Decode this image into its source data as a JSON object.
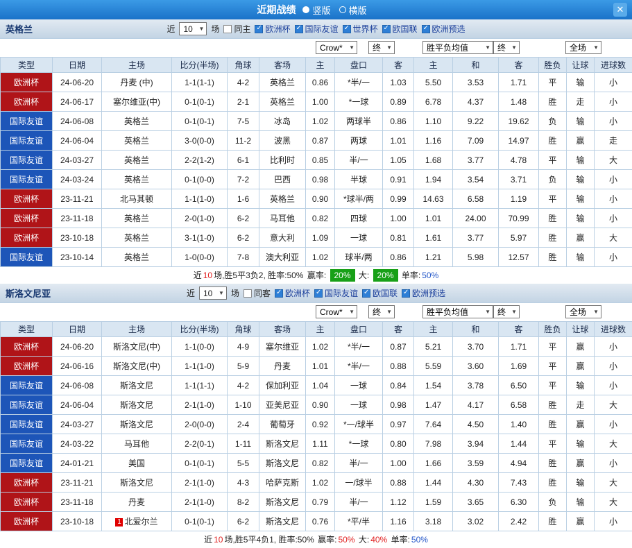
{
  "titlebar": {
    "title": "近期战绩",
    "vertical_label": "竖版",
    "horizontal_label": "横版",
    "close_glyph": "✕"
  },
  "colors": {
    "titlebar_top": "#3b9ae6",
    "titlebar_bottom": "#1a72c8",
    "close_bg": "#5aabea",
    "band_top": "#e2eaf2",
    "band_bottom": "#c3d4e4",
    "header_bg": "#d9e6f2",
    "grid_border": "#b9cfe3",
    "type_euro": "#b01418",
    "type_friendly": "#1d55b8",
    "team_green": "#009933",
    "team_red": "#e02020",
    "accent_red": "#e02020",
    "accent_green": "#089a30",
    "accent_orange": "#e07818",
    "accent_blue": "#2356c8",
    "badge_green": "#18a018",
    "navy_text": "#15356e",
    "league_label": "#1b3f9b"
  },
  "table_columns": [
    "类型",
    "日期",
    "主场",
    "比分(半场)",
    "角球",
    "客场",
    "主",
    "盘口",
    "客",
    "主",
    "和",
    "客",
    "胜负",
    "让球",
    "进球数"
  ],
  "sections": [
    {
      "team": "英格兰",
      "filter": {
        "near_label": "近",
        "count": "10",
        "matches_label": "场",
        "same_label": "同主",
        "same_checked": false,
        "leagues": [
          {
            "label": "欧洲杯",
            "checked": true
          },
          {
            "label": "国际友谊",
            "checked": true
          },
          {
            "label": "世界杯",
            "checked": true
          },
          {
            "label": "欧国联",
            "checked": true
          },
          {
            "label": "欧洲预选",
            "checked": true
          }
        ]
      },
      "selects": [
        {
          "name": "odds-company",
          "value": "Crow*"
        },
        {
          "name": "handicap-stage",
          "value": "终"
        },
        {
          "name": "europe-odds",
          "value": "胜平负均值"
        },
        {
          "name": "europe-stage",
          "value": "终"
        },
        {
          "name": "scope",
          "value": "全场"
        }
      ],
      "rows": [
        {
          "type": "欧洲杯",
          "tc": "euro",
          "date": "24-06-20",
          "home": "丹麦 (中)",
          "hc": "k",
          "score": "1-1(1-1)",
          "sc": "k",
          "corner": "4-2",
          "away": "英格兰",
          "ac": "g",
          "h": "0.86",
          "hcap": "*半/一",
          "a": "1.03",
          "eh": "5.50",
          "ed": "3.53",
          "ea": "1.71",
          "res": "平",
          "give": "输",
          "goal": "小"
        },
        {
          "type": "欧洲杯",
          "tc": "euro",
          "date": "24-06-17",
          "home": "塞尔维亚(中)",
          "hc": "k",
          "score": "0-1(0-1)",
          "sc": "k",
          "corner": "2-1",
          "away": "英格兰",
          "ac": "g",
          "h": "1.00",
          "hcap": "*一球",
          "a": "0.89",
          "eh": "6.78",
          "ed": "4.37",
          "ea": "1.48",
          "res": "胜",
          "give": "走",
          "goal": "小"
        },
        {
          "type": "国际友谊",
          "tc": "fri",
          "date": "24-06-08",
          "home": "英格兰",
          "hc": "g",
          "score": "0-1(0-1)",
          "sc": "k",
          "corner": "7-5",
          "away": "冰岛",
          "ac": "k",
          "h": "1.02",
          "hcap": "两球半",
          "a": "0.86",
          "eh": "1.10",
          "ed": "9.22",
          "ea": "19.62",
          "res": "负",
          "give": "输",
          "goal": "小"
        },
        {
          "type": "国际友谊",
          "tc": "fri",
          "date": "24-06-04",
          "home": "英格兰",
          "hc": "g",
          "score": "3-0(0-0)",
          "sc": "r",
          "corner": "11-2",
          "away": "波黑",
          "ac": "k",
          "h": "0.87",
          "hcap": "两球",
          "a": "1.01",
          "eh": "1.16",
          "ed": "7.09",
          "ea": "14.97",
          "res": "胜",
          "give": "赢",
          "goal": "走"
        },
        {
          "type": "国际友谊",
          "tc": "fri",
          "date": "24-03-27",
          "home": "英格兰",
          "hc": "g",
          "score": "2-2(1-2)",
          "sc": "k",
          "corner": "6-1",
          "away": "比利时",
          "ac": "k",
          "h": "0.85",
          "hcap": "半/一",
          "a": "1.05",
          "eh": "1.68",
          "ed": "3.77",
          "ea": "4.78",
          "res": "平",
          "give": "输",
          "goal": "大"
        },
        {
          "type": "国际友谊",
          "tc": "fri",
          "date": "24-03-24",
          "home": "英格兰",
          "hc": "g",
          "score": "0-1(0-0)",
          "sc": "k",
          "corner": "7-2",
          "away": "巴西",
          "ac": "k",
          "h": "0.98",
          "hcap": "半球",
          "a": "0.91",
          "eh": "1.94",
          "ed": "3.54",
          "ea": "3.71",
          "res": "负",
          "give": "输",
          "goal": "小"
        },
        {
          "type": "欧洲杯",
          "tc": "euro",
          "date": "23-11-21",
          "home": "北马其顿",
          "hc": "k",
          "score": "1-1(1-0)",
          "sc": "k",
          "corner": "1-6",
          "away": "英格兰",
          "ac": "g",
          "h": "0.90",
          "hcap": "*球半/两",
          "a": "0.99",
          "eh": "14.63",
          "ed": "6.58",
          "ea": "1.19",
          "res": "平",
          "give": "输",
          "goal": "小"
        },
        {
          "type": "欧洲杯",
          "tc": "euro",
          "date": "23-11-18",
          "home": "英格兰",
          "hc": "g",
          "score": "2-0(1-0)",
          "sc": "k",
          "corner": "6-2",
          "away": "马耳他",
          "ac": "k",
          "h": "0.82",
          "hcap": "四球",
          "a": "1.00",
          "eh": "1.01",
          "ed": "24.00",
          "ea": "70.99",
          "res": "胜",
          "give": "输",
          "goal": "小"
        },
        {
          "type": "欧洲杯",
          "tc": "euro",
          "date": "23-10-18",
          "home": "英格兰",
          "hc": "g",
          "score": "3-1(1-0)",
          "sc": "k",
          "corner": "6-2",
          "away": "意大利",
          "ac": "k",
          "h": "1.09",
          "hcap": "一球",
          "a": "0.81",
          "eh": "1.61",
          "ed": "3.77",
          "ea": "5.97",
          "res": "胜",
          "give": "赢",
          "goal": "大"
        },
        {
          "type": "国际友谊",
          "tc": "fri",
          "date": "23-10-14",
          "home": "英格兰",
          "hc": "g",
          "score": "1-0(0-0)",
          "sc": "k",
          "corner": "7-8",
          "away": "澳大利亚",
          "ac": "k",
          "h": "1.02",
          "hcap": "球半/两",
          "a": "0.86",
          "eh": "1.21",
          "ed": "5.98",
          "ea": "12.57",
          "res": "胜",
          "give": "输",
          "goal": "小"
        }
      ],
      "summary": [
        {
          "t": "近",
          "s": "n"
        },
        {
          "t": "10",
          "s": "red"
        },
        {
          "t": "场,胜5平3负2, 胜率:50%",
          "s": "n"
        },
        {
          "t": " 赢率: ",
          "s": "n"
        },
        {
          "t": "20%",
          "s": "badge"
        },
        {
          "t": " 大: ",
          "s": "n"
        },
        {
          "t": "20%",
          "s": "badge"
        },
        {
          "t": " 单率:",
          "s": "n"
        },
        {
          "t": "50%",
          "s": "blue"
        }
      ]
    },
    {
      "team": "斯洛文尼亚",
      "filter": {
        "near_label": "近",
        "count": "10",
        "matches_label": "场",
        "same_label": "同客",
        "same_checked": false,
        "leagues": [
          {
            "label": "欧洲杯",
            "checked": true
          },
          {
            "label": "国际友谊",
            "checked": true
          },
          {
            "label": "欧国联",
            "checked": true
          },
          {
            "label": "欧洲预选",
            "checked": true
          }
        ]
      },
      "selects": [
        {
          "name": "odds-company",
          "value": "Crow*"
        },
        {
          "name": "handicap-stage",
          "value": "终"
        },
        {
          "name": "europe-odds",
          "value": "胜平负均值"
        },
        {
          "name": "europe-stage",
          "value": "终"
        },
        {
          "name": "scope",
          "value": "全场"
        }
      ],
      "rows": [
        {
          "type": "欧洲杯",
          "tc": "euro",
          "date": "24-06-20",
          "home": "斯洛文尼(中)",
          "hc": "r",
          "score": "1-1(0-0)",
          "sc": "k",
          "corner": "4-9",
          "away": "塞尔维亚",
          "ac": "k",
          "h": "1.02",
          "hcap": "*半/一",
          "a": "0.87",
          "eh": "5.21",
          "ed": "3.70",
          "ea": "1.71",
          "res": "平",
          "give": "赢",
          "goal": "小"
        },
        {
          "type": "欧洲杯",
          "tc": "euro",
          "date": "24-06-16",
          "home": "斯洛文尼(中)",
          "hc": "r",
          "score": "1-1(1-0)",
          "sc": "k",
          "corner": "5-9",
          "away": "丹麦",
          "ac": "k",
          "h": "1.01",
          "hcap": "*半/一",
          "a": "0.88",
          "eh": "5.59",
          "ed": "3.60",
          "ea": "1.69",
          "res": "平",
          "give": "赢",
          "goal": "小"
        },
        {
          "type": "国际友谊",
          "tc": "fri",
          "date": "24-06-08",
          "home": "斯洛文尼",
          "hc": "r",
          "score": "1-1(1-1)",
          "sc": "k",
          "corner": "4-2",
          "away": "保加利亚",
          "ac": "k",
          "h": "1.04",
          "hcap": "一球",
          "a": "0.84",
          "eh": "1.54",
          "ed": "3.78",
          "ea": "6.50",
          "res": "平",
          "give": "输",
          "goal": "小"
        },
        {
          "type": "国际友谊",
          "tc": "fri",
          "date": "24-06-04",
          "home": "斯洛文尼",
          "hc": "r",
          "score": "2-1(1-0)",
          "sc": "k",
          "corner": "1-10",
          "away": "亚美尼亚",
          "ac": "k",
          "h": "0.90",
          "hcap": "一球",
          "a": "0.98",
          "eh": "1.47",
          "ed": "4.17",
          "ea": "6.58",
          "res": "胜",
          "give": "走",
          "goal": "大"
        },
        {
          "type": "国际友谊",
          "tc": "fri",
          "date": "24-03-27",
          "home": "斯洛文尼",
          "hc": "r",
          "score": "2-0(0-0)",
          "sc": "k",
          "corner": "2-4",
          "away": "葡萄牙",
          "ac": "k",
          "h": "0.92",
          "hcap": "*一/球半",
          "a": "0.97",
          "eh": "7.64",
          "ed": "4.50",
          "ea": "1.40",
          "res": "胜",
          "give": "赢",
          "goal": "小"
        },
        {
          "type": "国际友谊",
          "tc": "fri",
          "date": "24-03-22",
          "home": "马耳他",
          "hc": "k",
          "score": "2-2(0-1)",
          "sc": "k",
          "corner": "1-11",
          "away": "斯洛文尼",
          "ac": "r",
          "h": "1.11",
          "hcap": "*一球",
          "a": "0.80",
          "eh": "7.98",
          "ed": "3.94",
          "ea": "1.44",
          "res": "平",
          "give": "输",
          "goal": "大"
        },
        {
          "type": "国际友谊",
          "tc": "fri",
          "date": "24-01-21",
          "home": "美国",
          "hc": "k",
          "score": "0-1(0-1)",
          "sc": "k",
          "corner": "5-5",
          "away": "斯洛文尼",
          "ac": "r",
          "h": "0.82",
          "hcap": "半/一",
          "a": "1.00",
          "eh": "1.66",
          "ed": "3.59",
          "ea": "4.94",
          "res": "胜",
          "give": "赢",
          "goal": "小"
        },
        {
          "type": "欧洲杯",
          "tc": "euro",
          "date": "23-11-21",
          "home": "斯洛文尼",
          "hc": "r",
          "score": "2-1(1-0)",
          "sc": "k",
          "corner": "4-3",
          "away": "哈萨克斯",
          "ac": "k",
          "h": "1.02",
          "hcap": "一/球半",
          "a": "0.88",
          "eh": "1.44",
          "ed": "4.30",
          "ea": "7.43",
          "res": "胜",
          "give": "输",
          "goal": "大"
        },
        {
          "type": "欧洲杯",
          "tc": "euro",
          "date": "23-11-18",
          "home": "丹麦",
          "hc": "k",
          "score": "2-1(1-0)",
          "sc": "k",
          "corner": "8-2",
          "away": "斯洛文尼",
          "ac": "r",
          "h": "0.79",
          "hcap": "半/一",
          "a": "1.12",
          "eh": "1.59",
          "ed": "3.65",
          "ea": "6.30",
          "res": "负",
          "give": "输",
          "goal": "大"
        },
        {
          "type": "欧洲杯",
          "tc": "euro",
          "date": "23-10-18",
          "home": "北爱尔兰",
          "hc": "k",
          "home_badge": "1",
          "score": "0-1(0-1)",
          "sc": "k",
          "corner": "6-2",
          "away": "斯洛文尼",
          "ac": "r",
          "h": "0.76",
          "hcap": "*平/半",
          "a": "1.16",
          "eh": "3.18",
          "ed": "3.02",
          "ea": "2.42",
          "res": "胜",
          "give": "赢",
          "goal": "小"
        }
      ],
      "summary": [
        {
          "t": "近",
          "s": "n"
        },
        {
          "t": "10",
          "s": "red"
        },
        {
          "t": "场,胜5平4负1, 胜率:50%",
          "s": "n"
        },
        {
          "t": " 赢率:",
          "s": "n"
        },
        {
          "t": "50%",
          "s": "red"
        },
        {
          "t": " 大:",
          "s": "n"
        },
        {
          "t": "40%",
          "s": "red"
        },
        {
          "t": " 单率:",
          "s": "n"
        },
        {
          "t": "50%",
          "s": "blue"
        }
      ]
    }
  ]
}
